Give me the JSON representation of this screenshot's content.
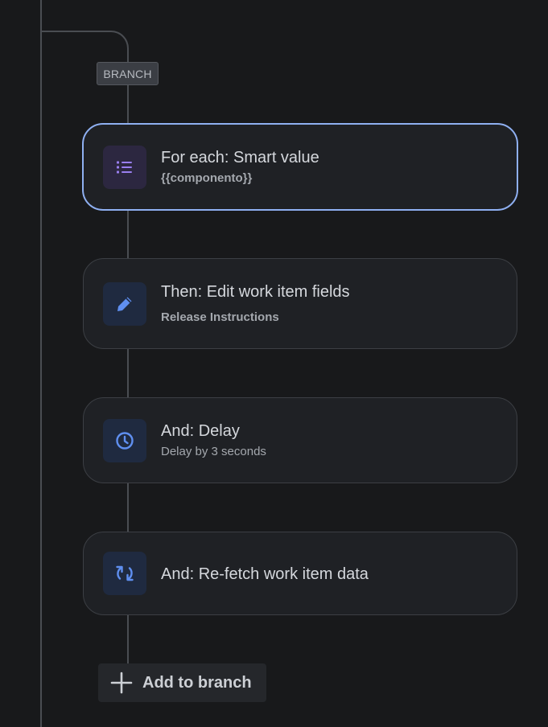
{
  "branch": {
    "tag_label": "BRANCH",
    "add_label": "Add to branch"
  },
  "steps": [
    {
      "title": "For each: Smart value",
      "subtitle": "{{componento}}",
      "icon": "list-icon",
      "icon_color": "#9a7ff0",
      "selected": true
    },
    {
      "title": "Then: Edit work item fields",
      "subtitle": "Release Instructions",
      "icon": "pencil-icon",
      "icon_color": "#5f8ff0",
      "selected": false
    },
    {
      "title": "And: Delay",
      "subtitle": "Delay by 3 seconds",
      "icon": "clock-icon",
      "icon_color": "#5f8ff0",
      "selected": false
    },
    {
      "title": "And: Re-fetch work item data",
      "subtitle": "",
      "icon": "refresh-icon",
      "icon_color": "#5f8ff0",
      "selected": false
    }
  ],
  "colors": {
    "background": "#18191b",
    "card": "#1f2125",
    "selected_border": "#8fb0f2",
    "connector": "#4a4d52"
  }
}
